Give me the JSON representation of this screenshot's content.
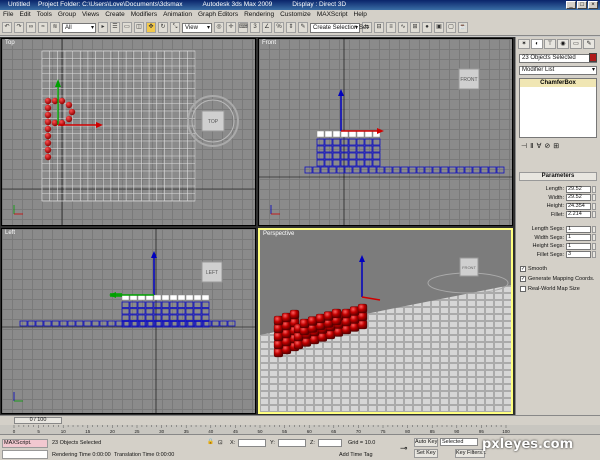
{
  "titlebar": {
    "doc": "Untitled",
    "project": "Project Folder: C:\\Users\\Love\\Documents\\3dsmax",
    "app": "Autodesk 3ds Max 2009",
    "display": "Display : Direct 3D"
  },
  "menu": [
    "File",
    "Edit",
    "Tools",
    "Group",
    "Views",
    "Create",
    "Modifiers",
    "Animation",
    "Graph Editors",
    "Rendering",
    "Customize",
    "MAXScript",
    "Help"
  ],
  "toolbar": {
    "selection_filter": "All",
    "coord_system": "View",
    "named_selection": "Create Selection Set"
  },
  "viewports": {
    "top": {
      "label": "Top",
      "cube_label": "TOP"
    },
    "front": {
      "label": "Front",
      "cube_label": "FRONT"
    },
    "left": {
      "label": "Left",
      "cube_label": "LEFT"
    },
    "perspective": {
      "label": "Perspective"
    }
  },
  "command_panel": {
    "object_name": "23 Objects Selected",
    "modifier_list": "Modifier List",
    "stack_item": "ChamferBox",
    "rollout": "Parameters",
    "params": [
      {
        "label": "Length:",
        "value": "29.52"
      },
      {
        "label": "Width:",
        "value": "29.52"
      },
      {
        "label": "Height:",
        "value": "24.354"
      },
      {
        "label": "Fillet:",
        "value": "2.214"
      }
    ],
    "segs": [
      {
        "label": "Length Segs:",
        "value": "1"
      },
      {
        "label": "Width Segs:",
        "value": "1"
      },
      {
        "label": "Height Segs:",
        "value": "1"
      },
      {
        "label": "Fillet Segs:",
        "value": "3"
      }
    ],
    "checks": [
      {
        "label": "Smooth",
        "checked": true
      },
      {
        "label": "Generate Mapping Coords.",
        "checked": true
      },
      {
        "label": "Real-World Map Size",
        "checked": false
      }
    ]
  },
  "time": {
    "slider": "0 / 100"
  },
  "trackbar": {
    "ticks": [
      "0",
      "5",
      "10",
      "15",
      "20",
      "25",
      "30",
      "35",
      "40",
      "45",
      "50",
      "55",
      "60",
      "65",
      "70",
      "75",
      "80",
      "85",
      "90",
      "95",
      "100"
    ]
  },
  "status": {
    "maxscript": "MAXScript.",
    "selected": "23 Objects Selected",
    "rendering_time": "Rendering Time 0:00:00",
    "translation_time": "Translation Time 0:00:00",
    "x_label": "X:",
    "y_label": "Y:",
    "z_label": "Z:",
    "grid": "Grid = 10.0",
    "add_time_tag": "Add Time Tag",
    "auto_key": "Auto Key",
    "set_key": "Set Key",
    "selected_dd": "Selected",
    "key_filters": "Key Filters..."
  },
  "watermark": "pxleyes.com"
}
